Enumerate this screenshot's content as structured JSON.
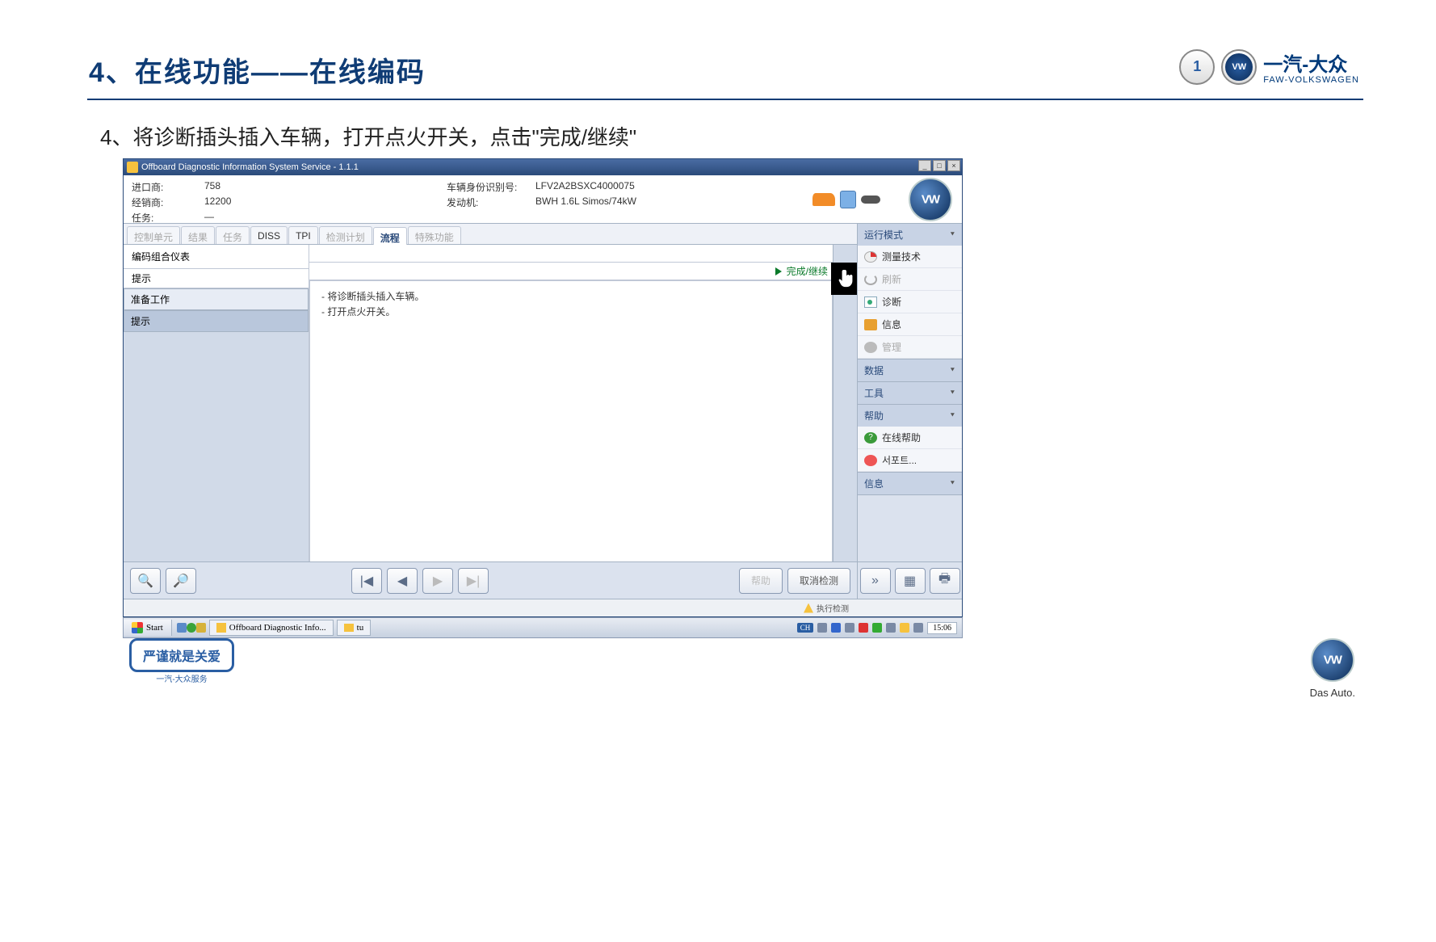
{
  "slide": {
    "title": "4、在线功能——在线编码",
    "instruction": "4、将诊断插头插入车辆，打开点火开关，点击\"完成/继续\""
  },
  "brand": {
    "company": "一汽-大众",
    "company_en": "FAW-VOLKSWAGEN",
    "dasauto": "Das Auto."
  },
  "badge": {
    "text": "严谨就是关爱",
    "sub": "一汽-大众服务"
  },
  "app": {
    "title": "Offboard Diagnostic Information System Service - 1.1.1",
    "header": {
      "importer_lbl": "进口商:",
      "importer_val": "758",
      "dealer_lbl": "经销商:",
      "dealer_val": "12200",
      "task_lbl": "任务:",
      "task_val": "—",
      "vin_lbl": "车辆身份识别号:",
      "vin_val": "LFV2A2BSXC4000075",
      "engine_lbl": "发动机:",
      "engine_val": "BWH 1.6L Simos/74kW"
    },
    "tabs": [
      {
        "label": "控制单元",
        "state": "disabled"
      },
      {
        "label": "结果",
        "state": "disabled"
      },
      {
        "label": "任务",
        "state": "disabled"
      },
      {
        "label": "DISS",
        "state": "enabled"
      },
      {
        "label": "TPI",
        "state": "enabled"
      },
      {
        "label": "检测计划",
        "state": "disabled"
      },
      {
        "label": "流程",
        "state": "active"
      },
      {
        "label": "特殊功能",
        "state": "disabled"
      }
    ],
    "panel": {
      "title": "编码组合仪表",
      "subtitle": "提示"
    },
    "list": [
      {
        "label": "准备工作",
        "selected": false
      },
      {
        "label": "提示",
        "selected": true
      }
    ],
    "complete_btn": "完成/继续",
    "center_text": "- 将诊断插头插入车辆。\n- 打开点火开关。",
    "footer": {
      "help": "帮助",
      "cancel": "取消检测"
    },
    "mode_panel": {
      "run_mode": "运行模式",
      "items_run": [
        {
          "label": "测量技术",
          "icon": "gauge",
          "disabled": false
        },
        {
          "label": "刷新",
          "icon": "refresh",
          "disabled": true
        },
        {
          "label": "诊断",
          "icon": "diag",
          "disabled": false
        },
        {
          "label": "信息",
          "icon": "info",
          "disabled": false
        },
        {
          "label": "管理",
          "icon": "gear",
          "disabled": true
        }
      ],
      "data": "数据",
      "tools": "工具",
      "help_head": "帮助",
      "items_help": [
        {
          "label": "在线帮助",
          "icon": "help"
        },
        {
          "label": "서포트...",
          "icon": "support"
        }
      ],
      "info_head": "信息"
    },
    "status_warn": "执行检测"
  },
  "taskbar": {
    "start": "Start",
    "app_task": "Offboard Diagnostic Info...",
    "folder": "tu",
    "lang": "CH",
    "time": "15:06"
  }
}
